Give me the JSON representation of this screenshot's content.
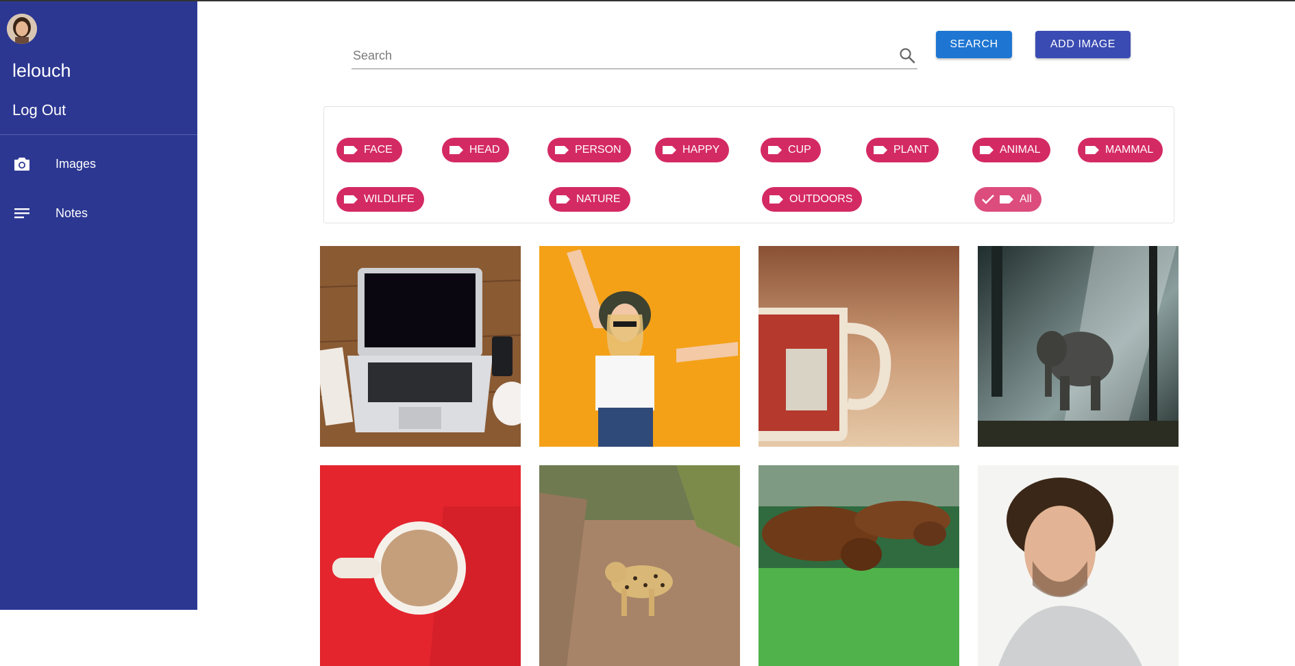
{
  "sidebar": {
    "username": "lelouch",
    "logout_label": "Log Out",
    "items": [
      {
        "label": "Images",
        "icon": "camera-icon"
      },
      {
        "label": "Notes",
        "icon": "notes-icon"
      }
    ]
  },
  "search": {
    "placeholder": "Search",
    "value": "",
    "search_button": "SEARCH",
    "add_button": "ADD IMAGE"
  },
  "tags": [
    "FACE",
    "HEAD",
    "PERSON",
    "HAPPY",
    "CUP",
    "PLANT",
    "ANIMAL",
    "MAMMAL",
    "WILDLIFE",
    "NATURE",
    "OUTDOORS",
    "All"
  ],
  "selected_tag": "All",
  "gallery": [
    {
      "subject": "laptop on wooden desk"
    },
    {
      "subject": "woman with hat on yellow background"
    },
    {
      "subject": "mug on table"
    },
    {
      "subject": "elephant in forest"
    },
    {
      "subject": "coffee cup on red background"
    },
    {
      "subject": "leopard on dirt road"
    },
    {
      "subject": "dogs on grass"
    },
    {
      "subject": "smiling man with curly hair"
    }
  ],
  "colors": {
    "sidebar": "#2c3792",
    "chip": "#d42a63",
    "search_button": "#1e76d2",
    "add_button": "#3a4bb3"
  }
}
